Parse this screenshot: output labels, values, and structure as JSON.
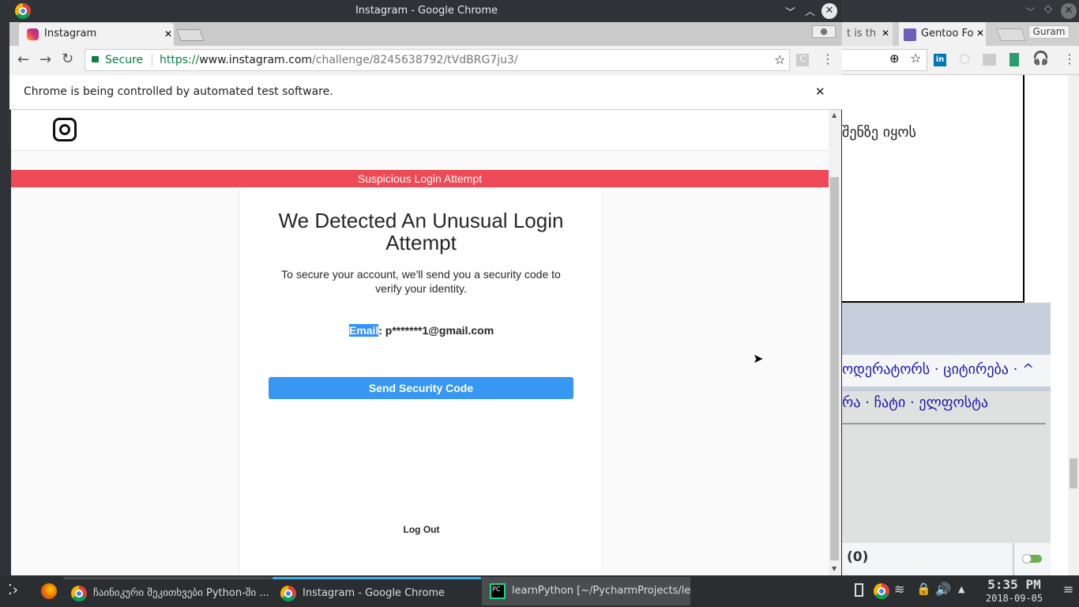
{
  "background_window": {
    "tabs": [
      {
        "label": "t is th"
      },
      {
        "label": "Gentoo Fo"
      }
    ],
    "profile": "Guram",
    "content": {
      "text1": "შენზე იყოს",
      "links1": "ოდერატორს  · ციტირება · ^",
      "links2": "რა · ჩატი · ელფოსტა",
      "count": "(0)"
    }
  },
  "window": {
    "title": "Instagram - Google Chrome",
    "tab_label": "Instagram",
    "secure_label": "Secure",
    "url": {
      "scheme": "https://",
      "host": "www.instagram.com",
      "path": "/challenge/8245638792/tVdBRG7ju3/"
    },
    "infobar": "Chrome is being controlled by automated test software."
  },
  "page": {
    "banner": "Suspicious Login Attempt",
    "banner_color": "#ed4956",
    "heading": "We Detected An Unusual Login Attempt",
    "description": "To secure your account, we'll send you a security code to verify your identity.",
    "contact_label": "Email",
    "contact_value": ": p*******1@gmail.com",
    "send_button": "Send Security Code",
    "button_color": "#3897f0",
    "logout": "Log Out"
  },
  "taskbar": {
    "tasks": [
      {
        "label": "ჩაინიკური შეკითხვები Python-ში ..."
      },
      {
        "label": "Instagram - Google Chrome"
      },
      {
        "label": "learnPython [~/PycharmProjects/le..."
      }
    ],
    "time": "5:35 PM",
    "date": "2018-09-05"
  }
}
